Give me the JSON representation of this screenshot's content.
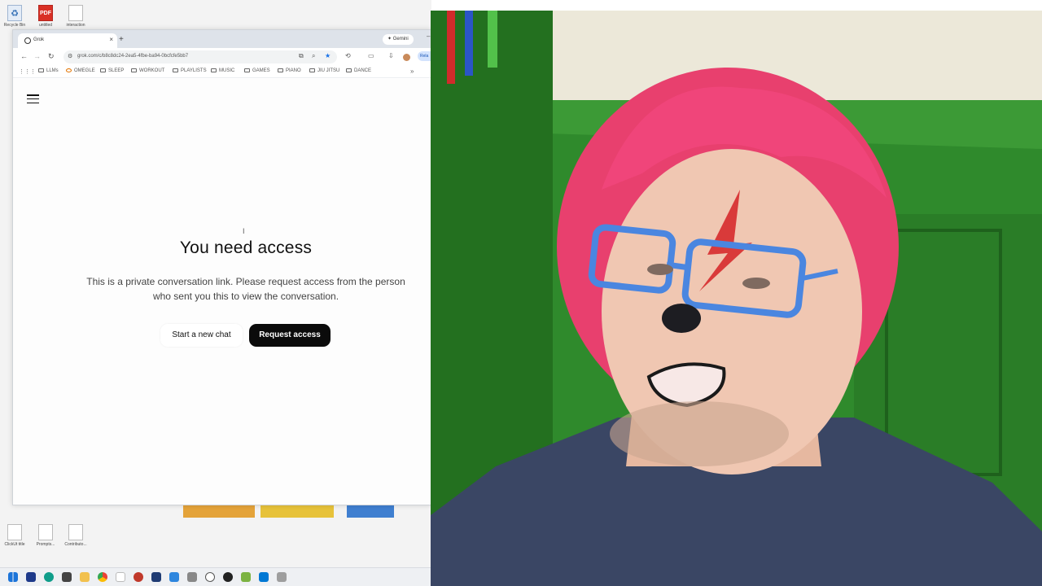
{
  "desktop": {
    "top_icons": [
      {
        "icon": "recycle-bin-icon",
        "caption": "Recycle Bin"
      },
      {
        "icon": "pdf-file-icon",
        "caption": "untitled"
      },
      {
        "icon": "document-icon",
        "caption": "interaction"
      }
    ],
    "bottom_icons": [
      {
        "icon": "document-icon",
        "caption": "ClickUt title"
      },
      {
        "icon": "document-icon",
        "caption": "Prompts..."
      },
      {
        "icon": "document-icon",
        "caption": "Contributo..."
      }
    ]
  },
  "browser": {
    "tab": {
      "title": "Grok",
      "close": "×",
      "new_tab": "+"
    },
    "gemini_label": "Gemini",
    "minimize": "–",
    "nav": {
      "back": "←",
      "forward": "→",
      "reload": "↻"
    },
    "url": "grok.com/c/b8c8dc24-2ea5-4fbe-ba94-0bcfcfe5bb7",
    "relaunch_label": "Rela",
    "bookmarks": [
      "LLMs",
      "OMEGLE",
      "SLEEP",
      "WORKOUT",
      "PLAYLISTS",
      "MUSIC",
      "GAMES",
      "PIANO",
      "JIU JITSU",
      "DANCE"
    ],
    "bookmarks_more": "»"
  },
  "page": {
    "cursor": "I",
    "heading": "You need access",
    "description": "This is a private conversation link. Please request access from the person who sent you this to view the conversation.",
    "start_chat_label": "Start a new chat",
    "request_access_label": "Request access"
  },
  "colors": {
    "primary_button": "#0b0b0b",
    "wall_green": "#2f8a2c",
    "hair_pink": "#f0457a",
    "glasses_blue": "#4a86e0"
  }
}
